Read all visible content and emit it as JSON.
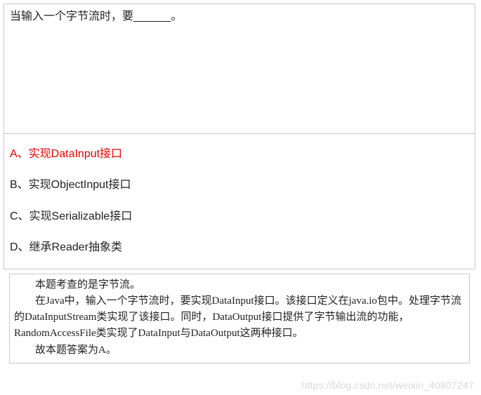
{
  "question": {
    "text": "当输入一个字节流时，要______。"
  },
  "options": {
    "a": "A、实现DataInput接口",
    "b": "B、实现ObjectInput接口",
    "c": "C、实现Serializable接口",
    "d": "D、继承Reader抽象类"
  },
  "explanation": {
    "p1": "本题考查的是字节流。",
    "p2": "在Java中，输入一个字节流时，要实现DataInput接口。该接口定义在java.io包中。处理字节流的DataInputStream类实现了该接口。同时，DataOutput接口提供了字节输出流的功能，RandomAccessFile类实现了DataInput与DataOutput这两种接口。",
    "p3": "故本题答案为A。"
  },
  "watermark": "https://blog.csdn.net/weixin_40807247"
}
